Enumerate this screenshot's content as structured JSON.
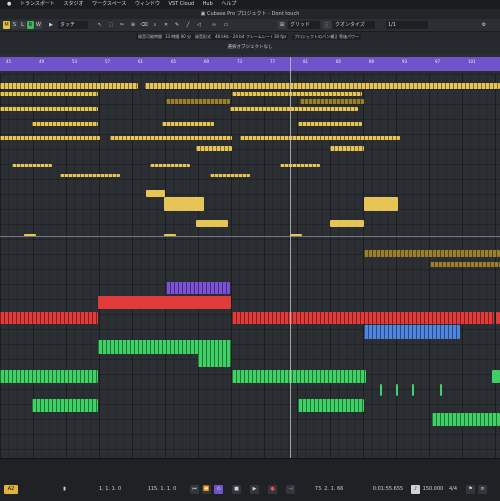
{
  "menubar": {
    "items": [
      "トランスポート",
      "スタジオ",
      "ワークスペース",
      "ウィンドウ",
      "VST Cloud",
      "Hub",
      "ヘルプ"
    ]
  },
  "window": {
    "title": "Cubase Pro プロジェクト - Dont touch"
  },
  "toolbar": {
    "m": "M",
    "s": "S",
    "l": "L",
    "r": "R",
    "w": "W",
    "mode": "タッチ",
    "snap": "グリッド",
    "quantize_label": "クオンタイズ",
    "quantize_value": "1/1"
  },
  "infoline": {
    "record_time": "録音可能時間",
    "record_time_value": "13 時間 00 分",
    "record_format_label": "録音形式",
    "record_format_value": "48 kHz - 24 bit",
    "frame_rate_label": "フレームレート",
    "frame_rate_value": "30 fps",
    "pan_label": "プロジェクトのパン補正",
    "pan_value": "等価パワー"
  },
  "selection": {
    "text": "選択オブジェクトなし"
  },
  "ruler": {
    "marks": [
      "45",
      "49",
      "53",
      "57",
      "61",
      "65",
      "69",
      "73",
      "77",
      "81",
      "85",
      "89",
      "93",
      "97",
      "101"
    ]
  },
  "transport": {
    "left_locator": "1. 1. 1. 0",
    "right_locator": "115. 1. 1. 0",
    "position_bars": "73. 2. 1. 66",
    "position_time": "0:01:55.655",
    "tempo": "150.000",
    "signature": "4/4",
    "record_mode": "A2"
  },
  "colors": {
    "ruler": "#6e53c9",
    "gold": "#e6c455",
    "red": "#e23b3b",
    "green": "#3fd066",
    "blue": "#4f86e0",
    "purple": "#7b52d6"
  }
}
